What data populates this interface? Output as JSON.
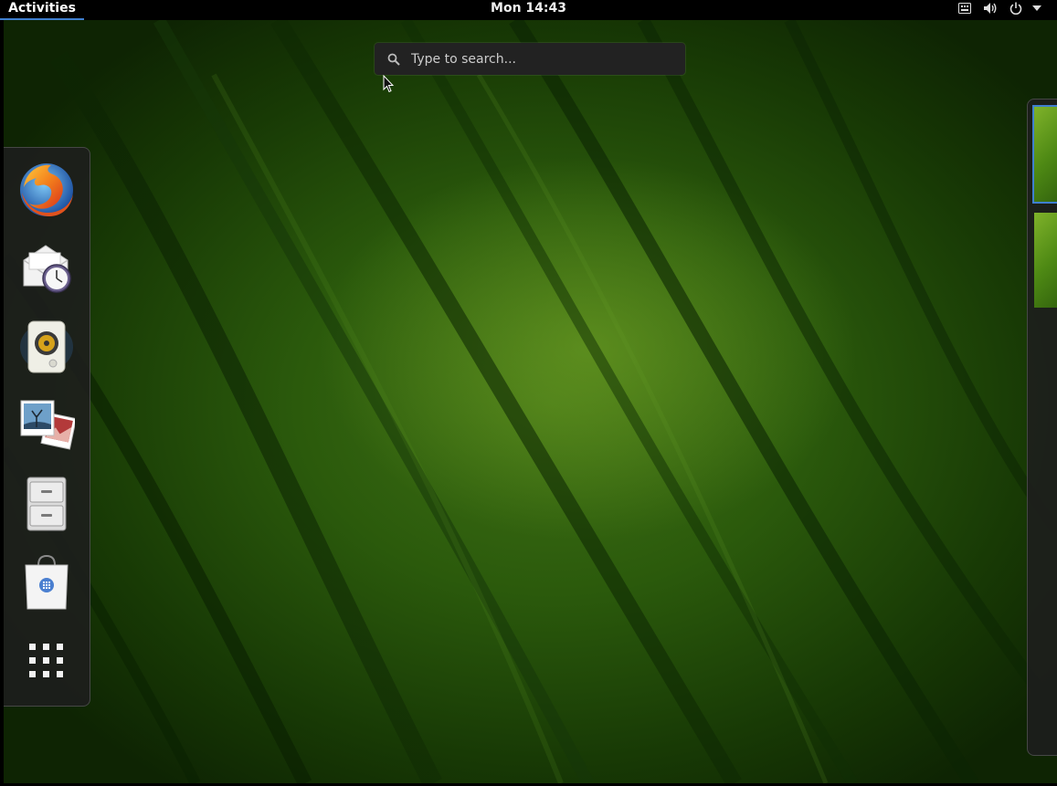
{
  "topbar": {
    "activities_label": "Activities",
    "clock": "Mon 14:43",
    "tray_icons": [
      "network-icon",
      "volume-icon",
      "power-icon",
      "system-menu-arrow-icon"
    ]
  },
  "search": {
    "placeholder": "Type to search..."
  },
  "dash": {
    "apps": [
      {
        "name": "firefox",
        "icon": "firefox-icon"
      },
      {
        "name": "evolution",
        "icon": "mail-clock-icon"
      },
      {
        "name": "rhythmbox",
        "icon": "speaker-icon"
      },
      {
        "name": "shotwell",
        "icon": "photos-icon"
      },
      {
        "name": "files",
        "icon": "filing-cabinet-icon"
      },
      {
        "name": "software",
        "icon": "shopping-bag-icon"
      },
      {
        "name": "show-applications",
        "icon": "app-grid-icon"
      }
    ]
  },
  "workspaces": {
    "count": 2,
    "active_index": 0
  },
  "colors": {
    "accent": "#3f7fcf",
    "topbar": "#000000",
    "dash_bg": "#1e1e1e",
    "wallpaper_main": "#2b5a0c"
  }
}
